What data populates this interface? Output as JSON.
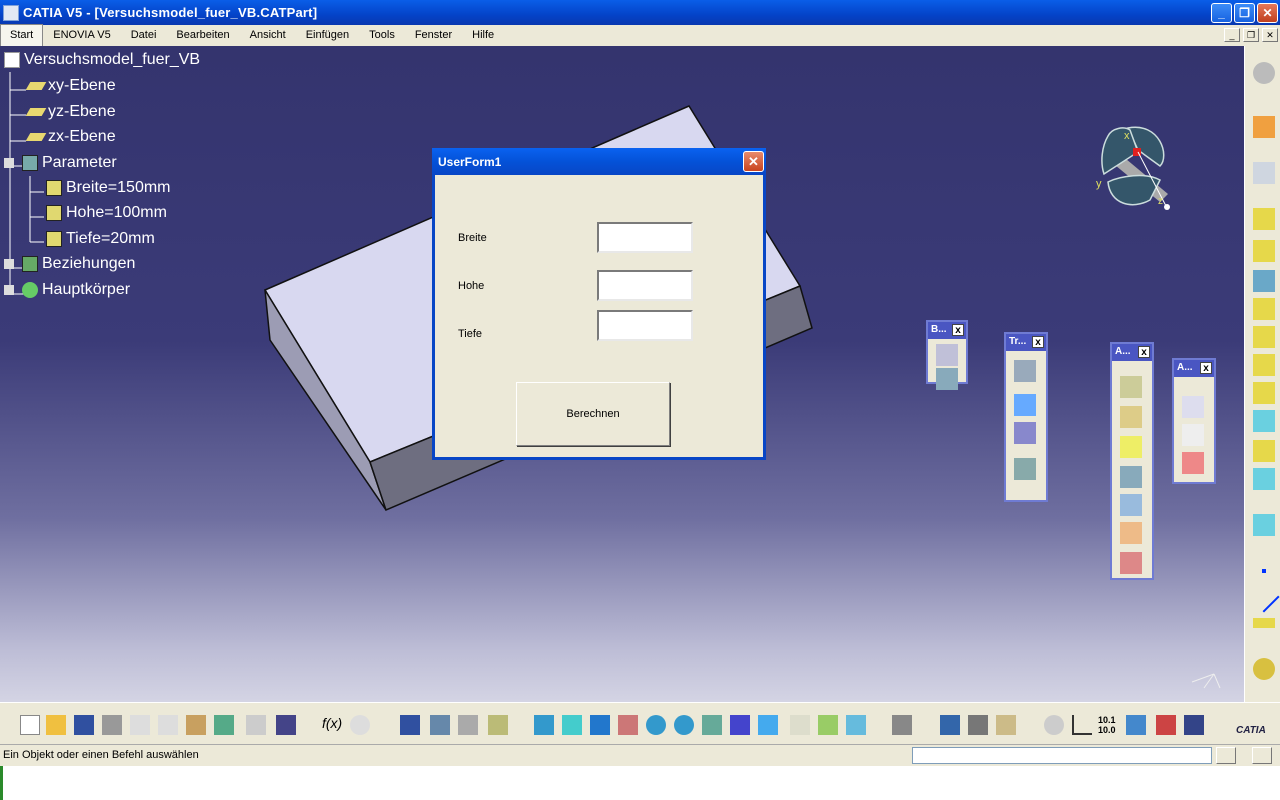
{
  "window": {
    "title": "CATIA V5 - [Versuchsmodel_fuer_VB.CATPart]"
  },
  "menu": [
    "Start",
    "ENOVIA V5",
    "Datei",
    "Bearbeiten",
    "Ansicht",
    "Einfügen",
    "Tools",
    "Fenster",
    "Hilfe"
  ],
  "tree": {
    "root": "Versuchsmodel_fuer_VB",
    "planes": [
      "xy-Ebene",
      "yz-Ebene",
      "zx-Ebene"
    ],
    "parameter_label": "Parameter",
    "parameters": [
      "Breite=150mm",
      "Hohe=100mm",
      "Tiefe=20mm"
    ],
    "relations_label": "Beziehungen",
    "body_label": "Hauptkörper"
  },
  "dialog": {
    "title": "UserForm1",
    "fields": [
      {
        "label": "Breite",
        "value": ""
      },
      {
        "label": "Hohe",
        "value": ""
      },
      {
        "label": "Tiefe",
        "value": ""
      }
    ],
    "button": "Berechnen"
  },
  "floating_toolbars": [
    "B...",
    "Tr...",
    "A...",
    "A..."
  ],
  "compass_axes": [
    "x",
    "y",
    "z"
  ],
  "status": {
    "message": "Ein Objekt oder einen Befehl auswählen"
  },
  "toolbar_texts": {
    "scale": "10.1",
    "scale2": "10.0",
    "logo": "CATIA"
  },
  "colors": {
    "titlebar": "#0a5ee8",
    "viewport_top": "#34346e",
    "toolbar_bg": "#ece9d8",
    "dialog_border": "#0846c6"
  }
}
